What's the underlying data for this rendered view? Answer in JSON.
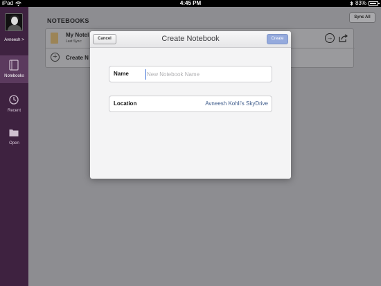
{
  "status_bar": {
    "device": "iPad",
    "time": "4:45 PM",
    "battery": "83%"
  },
  "sidebar": {
    "user_name": "Avneesh >",
    "items": [
      {
        "label": "Notebooks",
        "icon": "notebook-icon",
        "active": true
      },
      {
        "label": "Recent",
        "icon": "clock-icon",
        "active": false
      },
      {
        "label": "Open",
        "icon": "folder-icon",
        "active": false
      }
    ]
  },
  "main": {
    "section_title": "NOTEBOOKS",
    "sync_all_label": "Sync All",
    "notebooks": [
      {
        "title": "My Notel",
        "subtitle": "Last Sync:"
      }
    ],
    "create_label": "Create N"
  },
  "modal": {
    "title": "Create Notebook",
    "cancel_label": "Cancel",
    "create_label": "Create",
    "name_label": "Name",
    "name_placeholder": "New Notebook Name",
    "name_value": "",
    "location_label": "Location",
    "location_value": "Avneesh Kohli's SkyDrive"
  },
  "colors": {
    "sidebar": "#3e2240",
    "sidebar_active": "#5b3a5e",
    "create_button": "#95aadd",
    "location_text": "#3c5a8a"
  }
}
